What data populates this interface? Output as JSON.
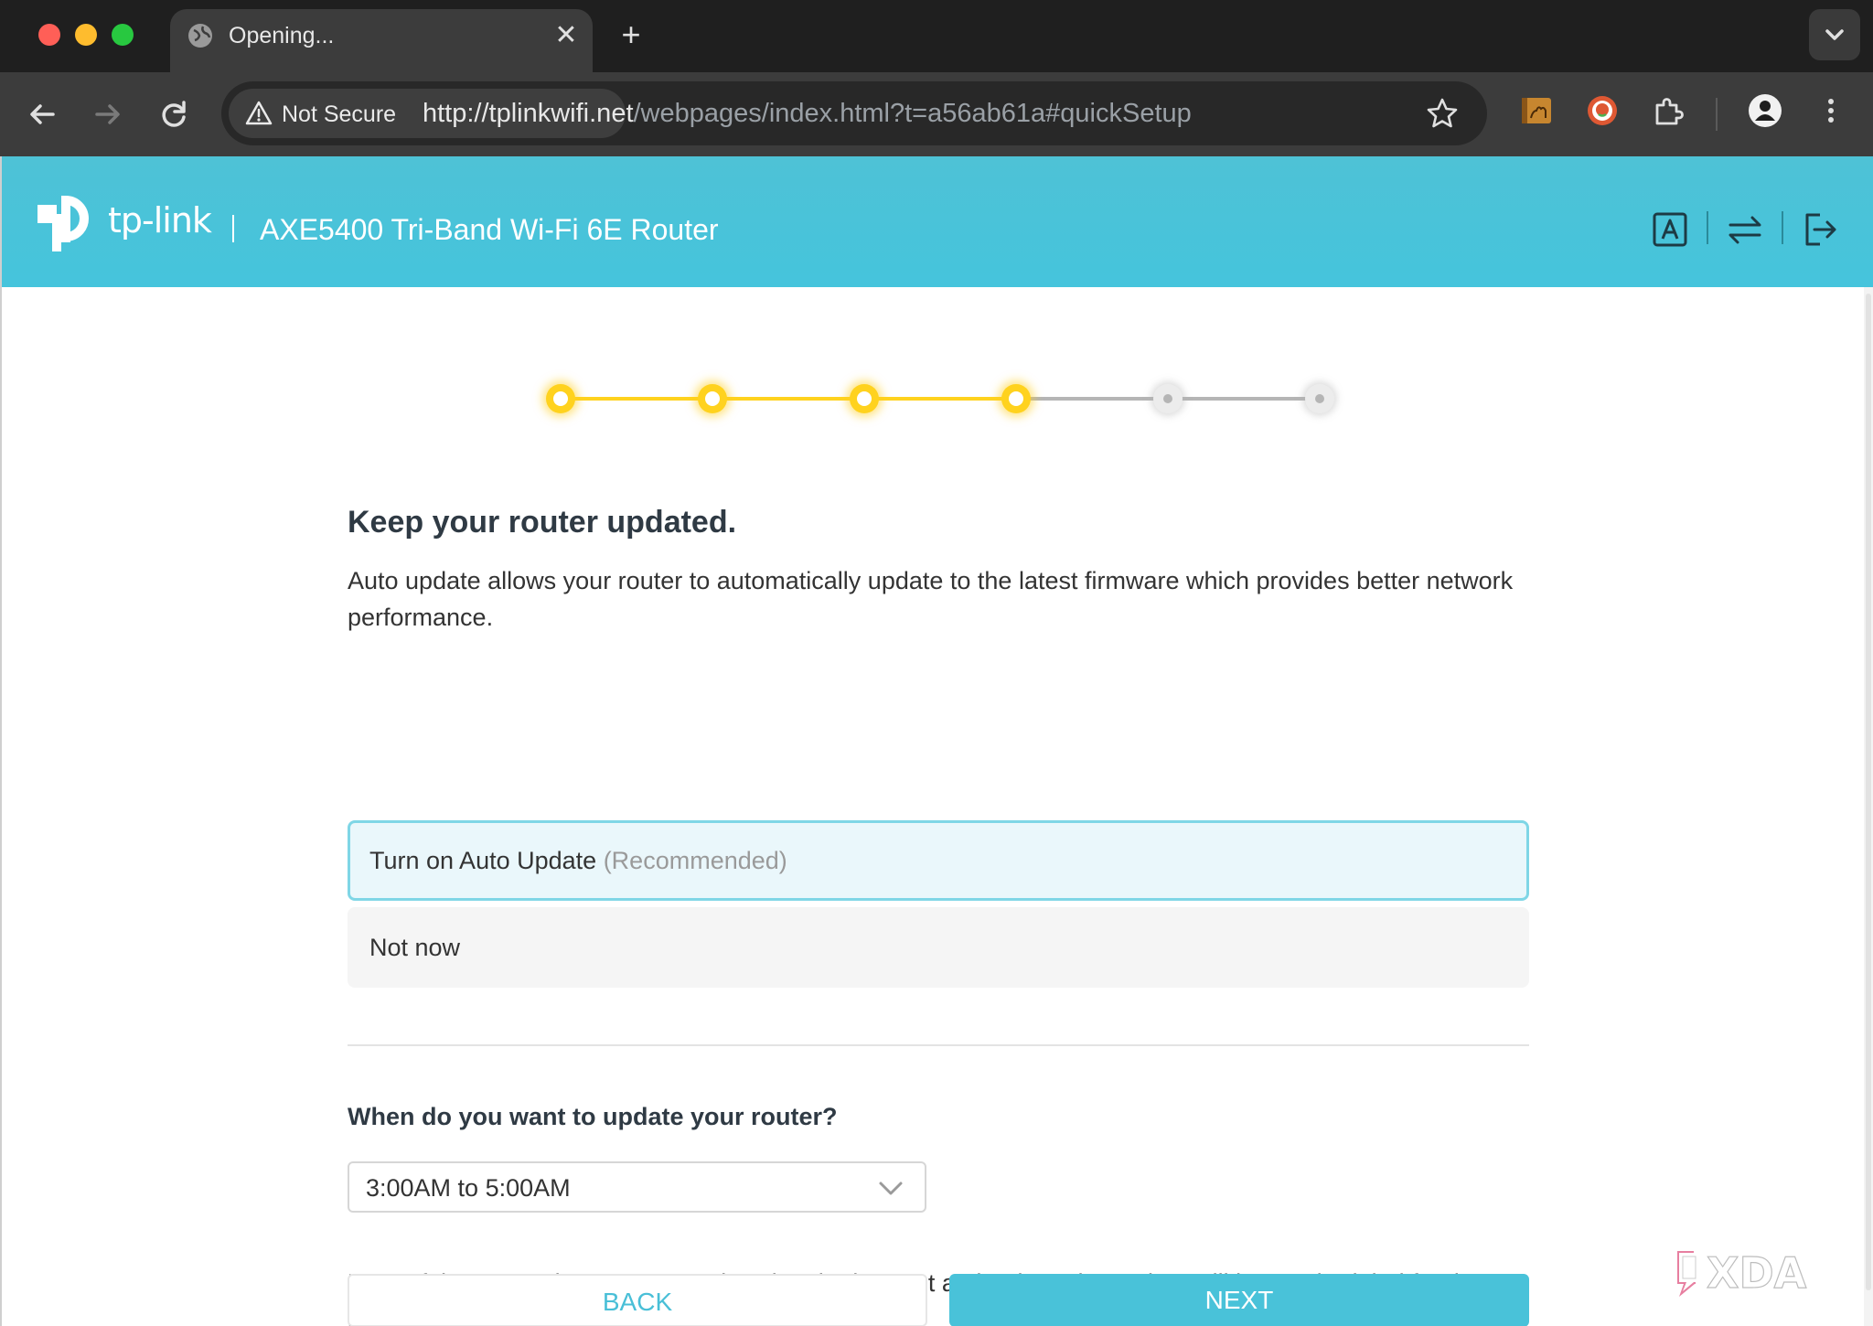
{
  "browser": {
    "tab_title": "Opening...",
    "security_label": "Not Secure",
    "url_host": "http://tplinkwifi.net",
    "url_path": "/webpages/index.html?t=a56ab61a#quickSetup"
  },
  "header": {
    "logo_text": "tp-link",
    "product_title": "AXE5400 Tri-Band Wi-Fi 6E Router"
  },
  "stepper": {
    "total_steps": 6,
    "completed_steps": 4,
    "active_color": "#ffd21e",
    "inactive_color": "#b5b5b5"
  },
  "main": {
    "heading": "Keep your router updated.",
    "description": "Auto update allows your router to automatically update to the latest firmware which provides better network performance.",
    "option_on_label": "Turn on Auto Update",
    "option_on_hint": "(Recommended)",
    "option_off_label": "Not now",
    "question": "When do you want to update your router?",
    "schedule_value": "3:00AM to 5:00AM",
    "note": "Note: If the router detects anyone is using the internet at the time, the update will be rescheduled for the next day."
  },
  "buttons": {
    "back": "BACK",
    "next": "NEXT"
  },
  "watermark": {
    "text": "XDA"
  },
  "colors": {
    "brand_teal": "#4ec2d6",
    "button_teal": "#49c2d9",
    "selected_border": "#7fd6e6"
  }
}
